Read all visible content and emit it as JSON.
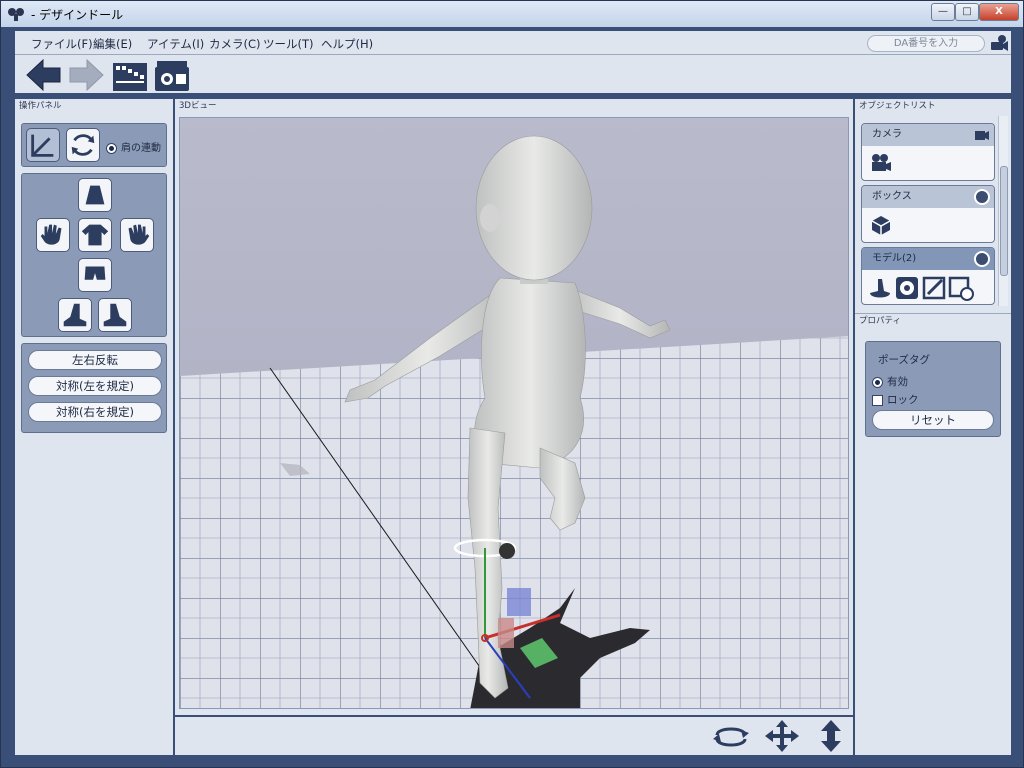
{
  "window": {
    "title": "- デザインドール",
    "controls": {
      "minimize": "—",
      "maximize": "□",
      "close": "X"
    }
  },
  "menu": {
    "items": [
      "ファイル(F)",
      "編集(E)",
      "アイテム(I)",
      "カメラ(C)",
      "ツール(T)",
      "ヘルプ(H)"
    ],
    "da_placeholder": "DA番号を入力"
  },
  "toolbar": {
    "icons": [
      "back-arrow-icon",
      "forward-arrow-icon",
      "film-clapper-icon",
      "camera-film-icon"
    ]
  },
  "left_panel": {
    "title": "操作パネル",
    "shoulder_link_label": "肩の連動",
    "buttons": [
      "左右反転",
      "対称(左を規定)",
      "対称(右を規定)"
    ]
  },
  "view": {
    "title": "3Dビュー"
  },
  "right_panel": {
    "title": "オブジェクトリスト",
    "objects": [
      {
        "label": "カメラ",
        "icon": "movie-camera-icon"
      },
      {
        "label": "ボックス",
        "icon": "cube-icon"
      },
      {
        "label": "モデル(2)",
        "icon": "model-tools-icon"
      }
    ],
    "property_title": "プロパティ",
    "pose_tag_title": "ポーズタグ",
    "valid_label": "有効",
    "lock_label": "ロック",
    "reset_label": "リセット"
  },
  "colors": {
    "window_frame": "#3a4f78",
    "panel_bg": "#dfe5ef",
    "group_bg": "#8b9ab6",
    "icon_dark": "#2d3d5f",
    "scene_bg": "#b7b9cc",
    "floor": "#dfe1eb"
  }
}
